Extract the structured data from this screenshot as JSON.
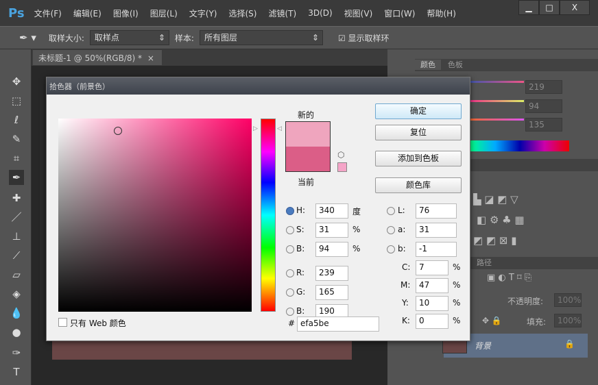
{
  "app": {
    "logo": "Ps",
    "menus": [
      "文件(F)",
      "编辑(E)",
      "图像(I)",
      "图层(L)",
      "文字(Y)",
      "选择(S)",
      "滤镜(T)",
      "3D(D)",
      "视图(V)",
      "窗口(W)",
      "帮助(H)"
    ],
    "window_controls": [
      "▁",
      "□",
      "X"
    ]
  },
  "options": {
    "sample_size_label": "取样大小:",
    "sample_size": "取样点",
    "sample_label": "样本:",
    "sample": "所有图层",
    "show_ring": "显示取样环",
    "show_ring_checked": true
  },
  "document": {
    "tab": "未标题-1 @ 50%(RGB/8) *",
    "close": "×"
  },
  "panels": {
    "color_tabs": [
      "颜色",
      "色板"
    ],
    "color_values": [
      "219",
      "94",
      "135"
    ],
    "paths_tab": "路径",
    "opacity_label": "不透明度:",
    "opacity": "100%",
    "fill_label": "填充:",
    "fill": "100%",
    "layer_name": "背景"
  },
  "dialog": {
    "title": "拾色器（前景色）",
    "new_label": "新的",
    "current_label": "当前",
    "new_color": "#efa5be",
    "current_color": "#db5e87",
    "buttons": {
      "ok": "确定",
      "reset": "复位",
      "add_swatch": "添加到色板",
      "libraries": "颜色库"
    },
    "hsb": [
      {
        "label": "H:",
        "value": "340",
        "unit": "度"
      },
      {
        "label": "S:",
        "value": "31",
        "unit": "%"
      },
      {
        "label": "B:",
        "value": "94",
        "unit": "%"
      }
    ],
    "rgb": [
      {
        "label": "R:",
        "value": "239"
      },
      {
        "label": "G:",
        "value": "165"
      },
      {
        "label": "B:",
        "value": "190"
      }
    ],
    "lab": [
      {
        "label": "L:",
        "value": "76"
      },
      {
        "label": "a:",
        "value": "31"
      },
      {
        "label": "b:",
        "value": "-1"
      }
    ],
    "cmyk": [
      {
        "label": "C:",
        "value": "7",
        "unit": "%"
      },
      {
        "label": "M:",
        "value": "47",
        "unit": "%"
      },
      {
        "label": "Y:",
        "value": "10",
        "unit": "%"
      },
      {
        "label": "K:",
        "value": "0",
        "unit": "%"
      }
    ],
    "hex_label": "#",
    "hex": "efa5be",
    "web_only": "只有 Web 颜色",
    "selected_mode": "H"
  }
}
